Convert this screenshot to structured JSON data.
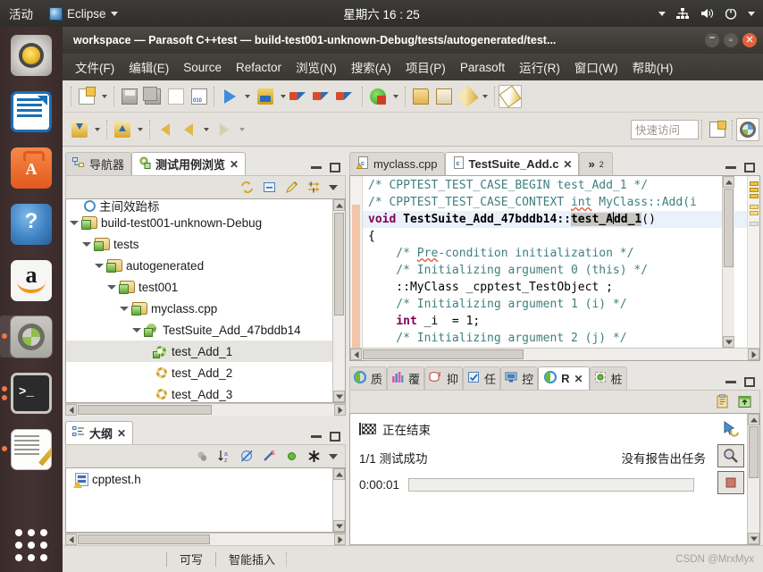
{
  "unity_top_bar": {
    "activities": "活动",
    "app_name": "Eclipse",
    "clock": "星期六 16 : 25",
    "icons": [
      "network-icon",
      "volume-icon",
      "power-icon",
      "chevron-down-icon"
    ]
  },
  "launcher": {
    "items": [
      {
        "name": "sound-converter",
        "icon": "sound-icon",
        "running": false,
        "selected": false
      },
      {
        "name": "libreoffice-writer",
        "icon": "document-icon",
        "running": false,
        "selected": false
      },
      {
        "name": "software-center",
        "icon": "briefcase-icon",
        "running": false,
        "selected": false
      },
      {
        "name": "help",
        "icon": "question-icon",
        "running": false,
        "selected": false
      },
      {
        "name": "amazon",
        "icon": "amazon-icon",
        "running": false,
        "selected": false
      },
      {
        "name": "eclipse",
        "icon": "eclipse-icon",
        "running": true,
        "selected": true
      },
      {
        "name": "terminal",
        "icon": "terminal-icon",
        "running": true,
        "selected": false
      },
      {
        "name": "text-editor",
        "icon": "notepad-icon",
        "running": true,
        "selected": false
      }
    ],
    "dash": "dash-grid-icon"
  },
  "window": {
    "title": "workspace — Parasoft C++test — build-test001-unknown-Debug/tests/autogenerated/test...",
    "buttons": {
      "minimize": "–",
      "maximize": "▫",
      "close": "✕"
    }
  },
  "menubar": {
    "items": [
      {
        "label": "文件(F)"
      },
      {
        "label": "编辑(E)"
      },
      {
        "label": "Source"
      },
      {
        "label": "Refactor"
      },
      {
        "label": "浏览(N)"
      },
      {
        "label": "搜索(A)"
      },
      {
        "label": "项目(P)"
      },
      {
        "label": "Parasoft"
      },
      {
        "label": "运行(R)"
      },
      {
        "label": "窗口(W)"
      },
      {
        "label": "帮助(H)"
      }
    ]
  },
  "toolbar_row1": {
    "buttons": [
      {
        "name": "new-button",
        "icon": "new-file-icon",
        "dropdown": true
      },
      {
        "name": "save-button",
        "icon": "save-icon",
        "dropdown": false
      },
      {
        "name": "save-all-button",
        "icon": "save-all-icon",
        "dropdown": false
      },
      {
        "name": "print-button",
        "icon": "print-icon",
        "dropdown": false
      },
      {
        "name": "hex-button",
        "icon": "binary-file-icon",
        "dropdown": false
      },
      {
        "name": "run-button",
        "icon": "run-icon",
        "dropdown": true
      },
      {
        "name": "debug-button",
        "icon": "debug-icon",
        "dropdown": true
      },
      {
        "name": "cpptest-run-button",
        "icon": "cpptest-icon",
        "dropdown": false
      },
      {
        "name": "cpptest-run-2-button",
        "icon": "cpptest-icon",
        "dropdown": false
      },
      {
        "name": "cpptest-run-3-button",
        "icon": "cpptest-icon",
        "dropdown": false
      },
      {
        "name": "test-config-button",
        "icon": "green-ball-icon",
        "dropdown": true
      },
      {
        "name": "open-folder-button",
        "icon": "folder-open-icon",
        "dropdown": false
      },
      {
        "name": "import-button",
        "icon": "folder-import-icon",
        "dropdown": false
      },
      {
        "name": "pencil-button",
        "icon": "pencil-icon",
        "dropdown": true
      },
      {
        "name": "brush-button",
        "icon": "brush-icon",
        "dropdown": false,
        "toggled": true
      }
    ]
  },
  "toolbar_row2": {
    "buttons": [
      {
        "name": "download-button",
        "icon": "arrow-down-icon",
        "dropdown": true
      },
      {
        "name": "upload-button",
        "icon": "arrow-up-icon",
        "dropdown": true
      },
      {
        "name": "back-history-button",
        "icon": "back-arrow-icon",
        "dropdown": false
      },
      {
        "name": "back-button",
        "icon": "back-arrow-icon",
        "dropdown": true
      },
      {
        "name": "forward-button",
        "icon": "forward-arrow-icon",
        "dropdown": true
      }
    ],
    "quick_access": {
      "placeholder": "快速访问",
      "value": ""
    },
    "perspective_buttons": [
      {
        "name": "open-perspective-button",
        "icon": "open-perspective-icon"
      },
      {
        "name": "cpptest-perspective-button",
        "icon": "eclipse-perspective-icon",
        "active": true
      }
    ]
  },
  "test_browser": {
    "tabs": [
      {
        "label": "导航器",
        "icon": "navigator-icon",
        "active": false,
        "closable": false
      },
      {
        "label": "测试用例浏览",
        "icon": "test-case-explorer-icon",
        "active": true,
        "closable": true
      }
    ],
    "window_buttons": {
      "minimize": "minimize-icon",
      "maximize": "maximize-icon"
    },
    "view_toolbar": [
      {
        "name": "refresh-button",
        "icon": "refresh-icon"
      },
      {
        "name": "collapse-all-button",
        "icon": "collapse-all-icon"
      },
      {
        "name": "edit-button",
        "icon": "pencil-icon"
      },
      {
        "name": "filter-button",
        "icon": "filter-icon"
      },
      {
        "name": "view-menu-button",
        "icon": "chevron-down-icon"
      }
    ],
    "tree": [
      {
        "label": "主间效跆标",
        "indent": 0,
        "icon": "blue-circle-icon",
        "twisty": "none",
        "partial": true,
        "selected": false
      },
      {
        "label": "build-test001-unknown-Debug",
        "indent": 0,
        "icon": "project-folder-icon",
        "twisty": "open",
        "selected": false
      },
      {
        "label": "tests",
        "indent": 1,
        "icon": "project-folder-icon",
        "twisty": "open",
        "selected": false
      },
      {
        "label": "autogenerated",
        "indent": 2,
        "icon": "project-folder-icon",
        "twisty": "open",
        "selected": false
      },
      {
        "label": "test001",
        "indent": 3,
        "icon": "project-folder-icon",
        "twisty": "open",
        "selected": false
      },
      {
        "label": "myclass.cpp",
        "indent": 4,
        "icon": "project-folder-icon",
        "twisty": "open",
        "selected": false
      },
      {
        "label": "TestSuite_Add_47bddb14",
        "indent": 5,
        "icon": "test-suite-icon",
        "twisty": "open",
        "selected": false
      },
      {
        "label": "test_Add_1",
        "indent": 6,
        "icon": "test-case-pass-icon",
        "twisty": "none",
        "selected": true
      },
      {
        "label": "test_Add_2",
        "indent": 6,
        "icon": "test-case-icon",
        "twisty": "none",
        "selected": false
      },
      {
        "label": "test_Add_3",
        "indent": 6,
        "icon": "test-case-icon",
        "twisty": "none",
        "selected": false
      }
    ]
  },
  "outline_view": {
    "tabs": [
      {
        "label": "大纲",
        "icon": "outline-icon",
        "active": true,
        "closable": true
      }
    ],
    "view_toolbar": [
      {
        "name": "hide-fields-button",
        "icon": "hide-fields-icon"
      },
      {
        "name": "sort-button",
        "icon": "sort-az-icon"
      },
      {
        "name": "hide-non-public-button",
        "icon": "hide-nonpublic-icon"
      },
      {
        "name": "hide-static-button",
        "icon": "hide-static-icon"
      },
      {
        "name": "show-members-button",
        "icon": "green-dot-icon"
      },
      {
        "name": "toggle-button",
        "icon": "asterisk-icon"
      },
      {
        "name": "view-menu-button",
        "icon": "chevron-down-icon"
      }
    ],
    "items": [
      {
        "label": "cpptest.h",
        "icon": "header-file-icon"
      }
    ]
  },
  "editor": {
    "tabs": [
      {
        "label": "myclass.cpp",
        "icon": "c-file-warning-icon",
        "active": false,
        "closable": false
      },
      {
        "label": "TestSuite_Add.c",
        "icon": "c-file-icon",
        "active": true,
        "closable": true
      }
    ],
    "overflow_label": "»",
    "overflow_count": "2",
    "window_buttons": {
      "minimize": "minimize-icon",
      "maximize": "maximize-icon"
    },
    "code_lines": [
      {
        "text": "/* CPPTEST_TEST_CASE_BEGIN test_Add_1 */",
        "kind": "comment",
        "highlight": false
      },
      {
        "text": "/* CPPTEST_TEST_CASE_CONTEXT int MyClass::Add(i",
        "kind": "comment",
        "highlight": false
      },
      {
        "text": "void TestSuite_Add_47bddb14::test_Add_1()",
        "kind": "declaration",
        "highlight": true
      },
      {
        "text": "{",
        "kind": "plain",
        "highlight": false
      },
      {
        "text": "    /* Pre-condition initialization */",
        "kind": "comment",
        "highlight": false
      },
      {
        "text": "    /* Initializing argument 0 (this) */",
        "kind": "comment",
        "highlight": false
      },
      {
        "text": "    ::MyClass _cpptest_TestObject ;",
        "kind": "plain",
        "highlight": false
      },
      {
        "text": "    /* Initializing argument 1 (i) */",
        "kind": "comment",
        "highlight": false
      },
      {
        "text": "    int _i  = 1;",
        "kind": "statement",
        "highlight": false
      },
      {
        "text": "    /* Initializing argument 2 (j) */",
        "kind": "comment",
        "highlight": false
      }
    ]
  },
  "bottom_panel": {
    "tabs": [
      {
        "label": "质",
        "icon": "quality-icon",
        "active": false,
        "closable": false
      },
      {
        "label": "覆",
        "icon": "coverage-icon",
        "active": false,
        "closable": false
      },
      {
        "label": "抑",
        "icon": "suppressions-icon",
        "active": false,
        "closable": false
      },
      {
        "label": "任",
        "icon": "tasks-icon",
        "active": false,
        "closable": false
      },
      {
        "label": "控",
        "icon": "console-icon",
        "active": false,
        "closable": false
      },
      {
        "label": "R",
        "icon": "results-icon",
        "active": true,
        "closable": true
      },
      {
        "label": "桩",
        "icon": "stubs-icon",
        "active": false,
        "closable": false
      }
    ],
    "window_buttons": {
      "minimize": "minimize-icon",
      "maximize": "maximize-icon"
    },
    "view_toolbar": [
      {
        "name": "copy-report-button",
        "icon": "clipboard-icon"
      },
      {
        "name": "export-report-button",
        "icon": "export-icon"
      }
    ],
    "results": {
      "status_label": "正在结束",
      "status_icon": "finish-flag-icon",
      "tests_label": "1/1 测试成功",
      "tasks_label": "没有报告出任务",
      "elapsed": "0:00:01",
      "progress_percent": 0,
      "side_buttons": [
        {
          "name": "rerun-button",
          "icon": "rerun-icon"
        },
        {
          "name": "search-results-button",
          "icon": "magnifier-icon"
        },
        {
          "name": "stop-button",
          "icon": "stop-icon"
        }
      ]
    }
  },
  "statusbar": {
    "writable": "可写",
    "insert_mode": "智能插入",
    "watermark": "CSDN @MrxMyx"
  }
}
